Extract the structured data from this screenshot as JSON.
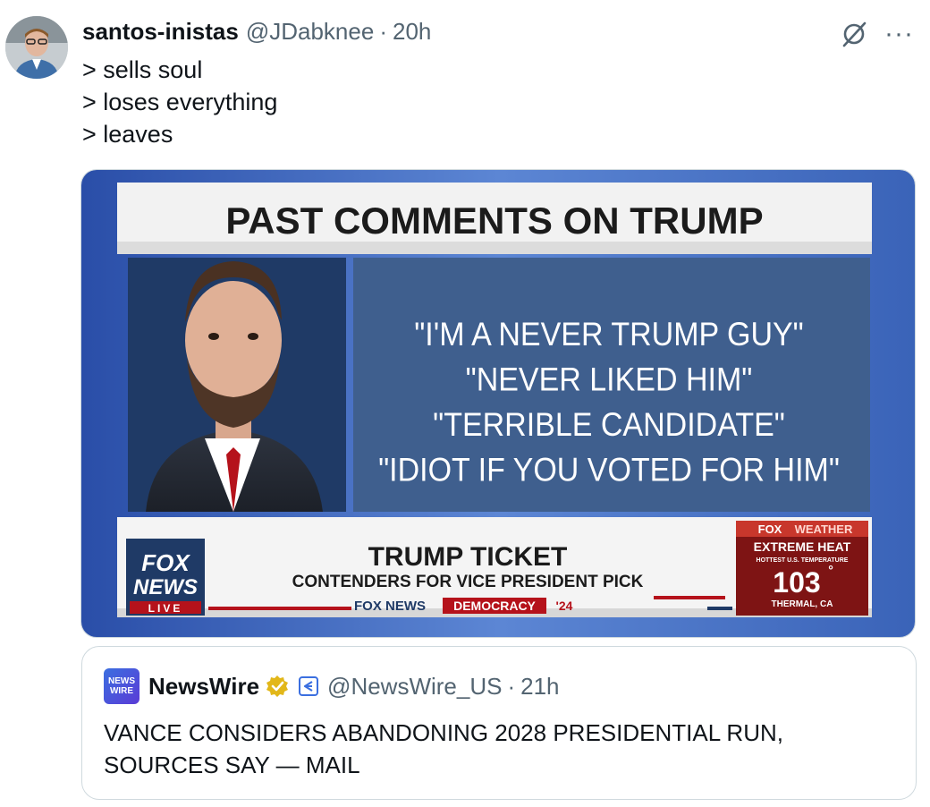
{
  "author": {
    "display_name": "santos-inistas",
    "handle": "@JDabknee",
    "separator": "·",
    "time": "20h"
  },
  "tweet_text": {
    "lines": [
      "> sells soul",
      "> loses everything",
      "> leaves"
    ]
  },
  "media": {
    "headline": "PAST COMMENTS ON TRUMP",
    "quotes": [
      "\"I'M A NEVER TRUMP GUY\"",
      "\"NEVER LIKED HIM\"",
      "\"TERRIBLE CANDIDATE\"",
      "\"IDIOT IF YOU VOTED FOR HIM\""
    ],
    "logo_line1": "FOX",
    "logo_line2": "NEWS",
    "logo_live": "LIVE",
    "ticker_title": "TRUMP TICKET",
    "ticker_sub": "CONTENDERS FOR VICE PRESIDENT PICK",
    "ticker_brand": "FOX NEWS",
    "ticker_tag": "DEMOCRACY",
    "ticker_year": "'24",
    "weather_brand1": "FOX",
    "weather_brand2": "WEATHER",
    "weather_alert": "EXTREME HEAT",
    "weather_sub": "HOTTEST U.S. TEMPERATURE",
    "weather_temp": "103",
    "weather_deg": "°",
    "weather_place": "THERMAL, CA",
    "colors": {
      "navy": "#1f3a66",
      "panel": "#3f5f8e",
      "red": "#b5121b"
    }
  },
  "quote": {
    "logo_line1": "NEWS",
    "logo_line2": "WIRE",
    "name": "NewsWire",
    "handle": "@NewsWire_US",
    "separator": "·",
    "time": "21h",
    "text": "VANCE CONSIDERS ABANDONING 2028 PRESIDENTIAL RUN, SOURCES SAY — MAIL"
  },
  "icons": {
    "grok": "grok-icon",
    "more": "more-icon",
    "verified": "verified-badge-icon",
    "affiliate": "affiliate-badge-icon"
  }
}
